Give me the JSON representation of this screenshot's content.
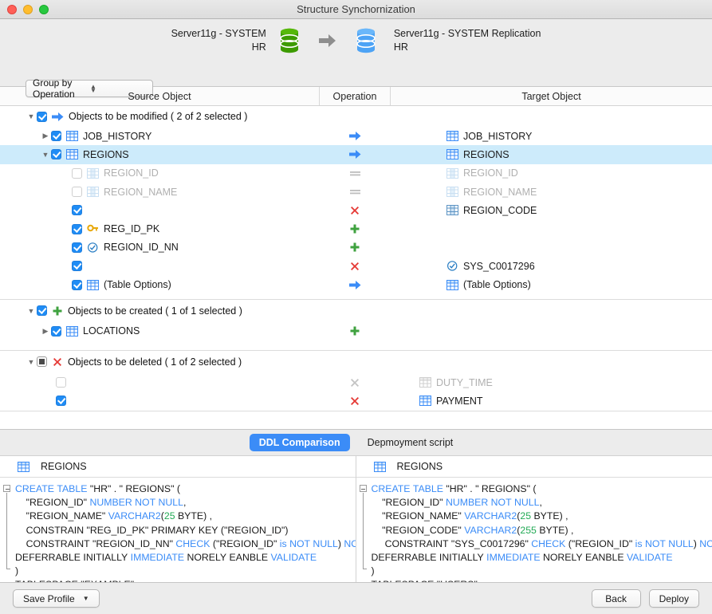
{
  "window": {
    "title": "Structure Synchornization"
  },
  "header": {
    "source_server": "Server11g - SYSTEM",
    "source_schema": "HR",
    "target_server": "Server11g - SYSTEM Replication",
    "target_schema": "HR",
    "group_by_label": "Group by Operation"
  },
  "columns": {
    "source": "Source Object",
    "operation": "Operation",
    "target": "Target Object"
  },
  "groups": [
    {
      "label_text": "Objects to be modified ( 2 of 2 selected )",
      "rows": [
        {
          "source": "JOB_HISTORY",
          "target": "JOB_HISTORY"
        },
        {
          "source": "REGIONS",
          "target": "REGIONS"
        },
        {
          "source": "REGION_ID",
          "target": "REGION_ID"
        },
        {
          "source": "REGION_NAME",
          "target": "REGION_NAME"
        },
        {
          "source": "",
          "target": "REGION_CODE"
        },
        {
          "source": "REG_ID_PK",
          "target": ""
        },
        {
          "source": "REGION_ID_NN",
          "target": ""
        },
        {
          "source": "",
          "target": "SYS_C0017296"
        },
        {
          "source": "(Table Options)",
          "target": "(Table Options)"
        }
      ]
    },
    {
      "label_text": "Objects to be created ( 1 of 1 selected )",
      "rows": [
        {
          "source": "LOCATIONS",
          "target": ""
        }
      ]
    },
    {
      "label_text": "Objects to be deleted ( 1 of 2 selected )",
      "rows": [
        {
          "source": "",
          "target": "DUTY_TIME"
        },
        {
          "source": "",
          "target": "PAYMENT"
        }
      ]
    }
  ],
  "tabs": {
    "ddl_comparison": "DDL Comparison",
    "deployment_script": "Depmoyment script"
  },
  "ddl": {
    "left": {
      "title": "REGIONS",
      "lines": [
        {
          "parts": [
            {
              "t": "CREATE TABLE ",
              "c": "kw"
            },
            {
              "t": "\"HR\" . \" REGIONS\" (",
              "c": ""
            }
          ],
          "indent": 0
        },
        {
          "parts": [
            {
              "t": "    \"REGION_ID\" ",
              "c": ""
            },
            {
              "t": "NUMBER NOT NULL",
              "c": "kw"
            },
            {
              "t": ",",
              "c": ""
            }
          ],
          "indent": 1
        },
        {
          "parts": [
            {
              "t": "    \"REGION_NAME\" ",
              "c": ""
            },
            {
              "t": "VARCHAR2",
              "c": "kw"
            },
            {
              "t": "(",
              "c": ""
            },
            {
              "t": "25",
              "c": "num"
            },
            {
              "t": " BYTE) ,",
              "c": ""
            }
          ],
          "indent": 1
        },
        {
          "parts": [
            {
              "t": "    CONSTRAIN \"REG_ID_PK\" PRIMARY KEY (\"REGION_ID\")",
              "c": ""
            }
          ],
          "indent": 1
        },
        {
          "parts": [
            {
              "t": "    CONSTRAINT \"REGION_ID_NN\" ",
              "c": ""
            },
            {
              "t": "CHECK",
              "c": "kw"
            },
            {
              "t": " (\"REGION_ID\" ",
              "c": ""
            },
            {
              "t": "is NOT NULL",
              "c": "kw"
            },
            {
              "t": ") ",
              "c": ""
            },
            {
              "t": "NOT",
              "c": "kw"
            }
          ],
          "indent": 1
        },
        {
          "parts": [
            {
              "t": "DEFERRABLE INITIALLY ",
              "c": ""
            },
            {
              "t": "IMMEDIATE",
              "c": "kw"
            },
            {
              "t": " NORELY EANBLE ",
              "c": ""
            },
            {
              "t": "VALIDATE",
              "c": "kw"
            }
          ],
          "indent": 0
        },
        {
          "parts": [
            {
              "t": ")",
              "c": ""
            }
          ],
          "indent": 0
        },
        {
          "parts": [
            {
              "t": "TABLESPACE \"EXAMPLE\"",
              "c": ""
            }
          ],
          "indent": 0
        }
      ]
    },
    "right": {
      "title": "REGIONS",
      "lines": [
        {
          "parts": [
            {
              "t": "CREATE TABLE ",
              "c": "kw"
            },
            {
              "t": "\"HR\" . \" REGIONS\" (",
              "c": ""
            }
          ],
          "indent": 0
        },
        {
          "parts": [
            {
              "t": "    \"REGION_ID\" ",
              "c": ""
            },
            {
              "t": "NUMBER NOT NULL",
              "c": "kw"
            },
            {
              "t": ",",
              "c": ""
            }
          ],
          "indent": 1
        },
        {
          "parts": [
            {
              "t": "    \"REGION_NAME\" ",
              "c": ""
            },
            {
              "t": "VARCHAR2",
              "c": "kw"
            },
            {
              "t": "(",
              "c": ""
            },
            {
              "t": "25",
              "c": "num"
            },
            {
              "t": " BYTE) ,",
              "c": ""
            }
          ],
          "indent": 1
        },
        {
          "parts": [
            {
              "t": "    \"REGION_CODE\" ",
              "c": ""
            },
            {
              "t": "VARCHAR2",
              "c": "kw"
            },
            {
              "t": "(",
              "c": ""
            },
            {
              "t": "255",
              "c": "num"
            },
            {
              "t": " BYTE) ,",
              "c": ""
            }
          ],
          "indent": 1
        },
        {
          "parts": [
            {
              "t": "     CONSTRAINT \"SYS_C0017296\" ",
              "c": ""
            },
            {
              "t": "CHECK",
              "c": "kw"
            },
            {
              "t": " (\"REGION_ID\" ",
              "c": ""
            },
            {
              "t": "is NOT NULL",
              "c": "kw"
            },
            {
              "t": ") ",
              "c": ""
            },
            {
              "t": "NOT",
              "c": "kw"
            }
          ],
          "indent": 1
        },
        {
          "parts": [
            {
              "t": "DEFERRABLE INITIALLY ",
              "c": ""
            },
            {
              "t": "IMMEDIATE",
              "c": "kw"
            },
            {
              "t": " NORELY EANBLE ",
              "c": ""
            },
            {
              "t": "VALIDATE",
              "c": "kw"
            }
          ],
          "indent": 0
        },
        {
          "parts": [
            {
              "t": ")",
              "c": ""
            }
          ],
          "indent": 0
        },
        {
          "parts": [
            {
              "t": "TABLESPACE \"USERS\"",
              "c": ""
            }
          ],
          "indent": 0
        }
      ]
    }
  },
  "footer": {
    "save_profile": "Save Profile",
    "back": "Back",
    "deploy": "Deploy"
  },
  "colors": {
    "accent": "#3b8cf7",
    "add": "#3fa23f",
    "delete": "#e53935",
    "selection": "#cdebfb",
    "source_db": "#3d9b00",
    "target_db": "#4da3f5"
  }
}
